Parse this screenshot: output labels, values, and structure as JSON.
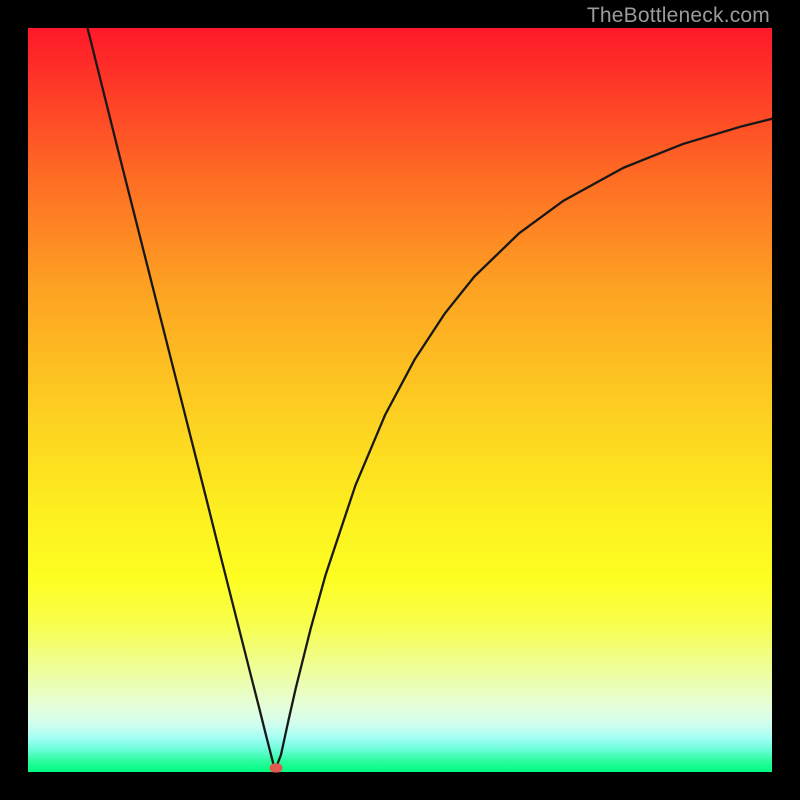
{
  "watermark": "TheBottleneck.com",
  "colors": {
    "background": "#000000",
    "curve_stroke": "#181818",
    "marker_fill": "#e05a4e"
  },
  "marker": {
    "x_frac": 0.333,
    "y_frac": 0.995
  },
  "chart_data": {
    "type": "line",
    "title": "",
    "xlabel": "",
    "ylabel": "",
    "xlim": [
      0,
      100
    ],
    "ylim": [
      0,
      100
    ],
    "series": [
      {
        "name": "bottleneck-curve",
        "x": [
          8,
          10,
          12,
          14,
          16,
          18,
          20,
          22,
          24,
          26,
          28,
          30,
          31,
          32,
          33,
          33.3,
          34,
          35,
          36,
          38,
          40,
          44,
          48,
          52,
          56,
          60,
          66,
          72,
          80,
          88,
          96,
          100
        ],
        "values": [
          100,
          92,
          84,
          76.1,
          68.2,
          60.3,
          52.4,
          44.5,
          36.6,
          28.6,
          20.7,
          12.8,
          8.9,
          4.9,
          1.0,
          0.5,
          2.3,
          6.9,
          11.3,
          19.3,
          26.5,
          38.5,
          48.0,
          55.5,
          61.6,
          66.6,
          72.4,
          76.8,
          81.2,
          84.4,
          86.8,
          87.8
        ]
      }
    ],
    "annotations": [
      {
        "name": "minimum-marker",
        "x": 33.3,
        "y": 0.5
      }
    ],
    "grid": false,
    "legend": false
  }
}
